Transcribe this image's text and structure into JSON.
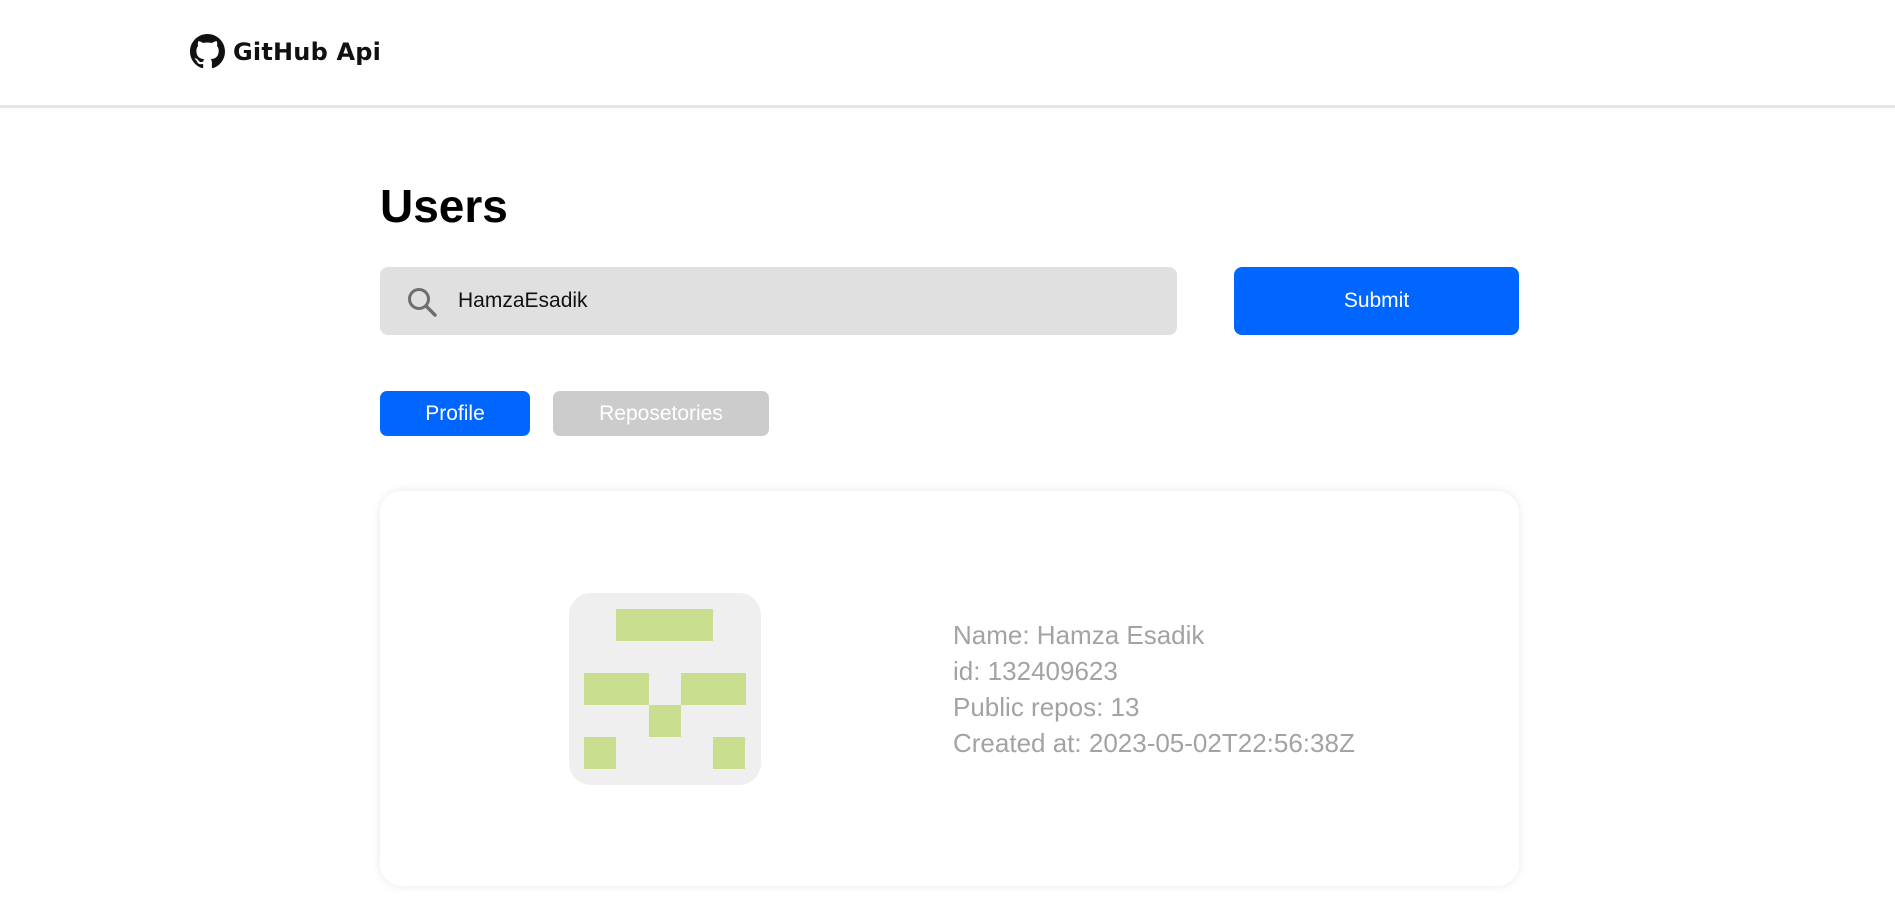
{
  "header": {
    "brand_name": "GitHub Api",
    "brand_icon": "github-icon"
  },
  "main": {
    "title": "Users",
    "search": {
      "icon": "search-icon",
      "value": "HamzaEsadik",
      "placeholder": ""
    },
    "submit_label": "Submit",
    "tabs": [
      {
        "label": "Profile",
        "active": true
      },
      {
        "label": "Reposetories",
        "active": false
      }
    ]
  },
  "profile": {
    "avatar_colors": {
      "background": "#efefef",
      "foreground": "#c9de8f"
    },
    "name_line": "Name: Hamza Esadik",
    "id_line": "id: 132409623",
    "repos_line": "Public repos: 13",
    "created_line": "Created at: 2023-05-02T22:56:38Z"
  },
  "colors": {
    "accent": "#0066ff",
    "inactive_tab": "#cccccc",
    "search_bg": "#e0e0e0",
    "muted_text": "#a3a3a3"
  }
}
